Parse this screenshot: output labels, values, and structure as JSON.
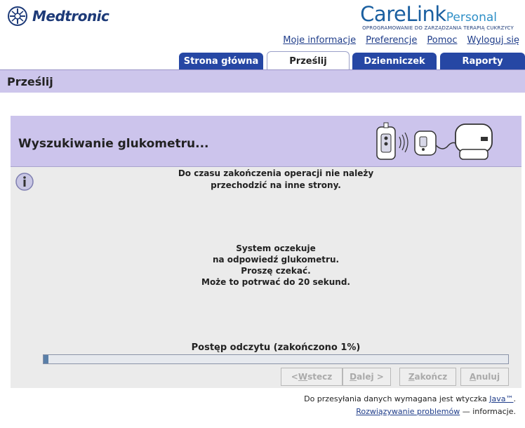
{
  "header": {
    "logo_text": "Medtronic",
    "brand_main": "CareLink",
    "brand_sub": "Personal",
    "brand_tagline": "OPROGRAMOWANIE DO ZARZĄDZANIA TERAPIĄ CUKRZYCY",
    "links": {
      "my_info": "Moje informacje",
      "preferences": "Preferencje",
      "help": "Pomoc",
      "logout": "Wyloguj się"
    }
  },
  "tabs": {
    "home": "Strona główna",
    "send": "Prześlij",
    "diary": "Dzienniczek",
    "reports": "Raporty",
    "active": "send"
  },
  "page_title": "Prześlij",
  "panel": {
    "heading": "Wyszukiwanie glukometru...",
    "warning_line1": "Do czasu zakończenia operacji nie należy",
    "warning_line2": "przechodzić na inne strony.",
    "wait_line1": "System oczekuje",
    "wait_line2": "na odpowiedź glukometru.",
    "wait_line3": "Proszę czekać.",
    "wait_line4": "Może to potrwać do 20 sekund.",
    "progress_label": "Postęp odczytu (zakończono 1%)",
    "progress_percent": 1
  },
  "buttons": {
    "back_prefix": "< ",
    "back_key": "W",
    "back_rest": "stecz",
    "next_key": "D",
    "next_rest": "alej >",
    "finish_key": "Z",
    "finish_rest": "akończ",
    "cancel_key": "A",
    "cancel_rest": "nuluj"
  },
  "footer": {
    "line1_text": "Do przesyłania danych wymagana jest wtyczka ",
    "java_link": "Java™",
    "line1_end": ".",
    "problems_link": "Rozwiązywanie problemów",
    "line2_text": " — informacje."
  },
  "colors": {
    "tab_blue": "#2647a4",
    "lavender": "#cdc6ec",
    "link": "#1f3d8a",
    "brand_blue": "#1a5fa0"
  }
}
